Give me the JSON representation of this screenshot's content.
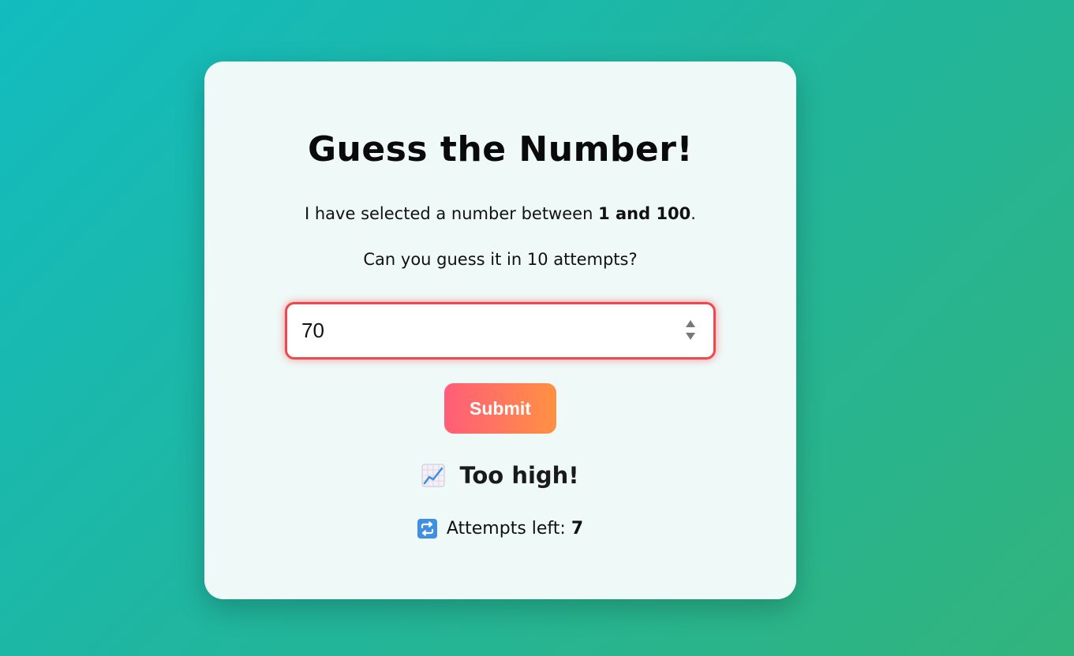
{
  "game": {
    "title": "Guess the Number!",
    "intro_prefix": "I have selected a number between ",
    "intro_range": "1 and 100",
    "intro_suffix": ".",
    "challenge": "Can you guess it in 10 attempts?"
  },
  "guess_input": {
    "value": "70"
  },
  "submit": {
    "label": "Submit"
  },
  "feedback": {
    "icon": "chart-increasing-icon",
    "text": "Too high!"
  },
  "attempts": {
    "icon": "repeat-icon",
    "label": "Attempts left: ",
    "count": "7"
  },
  "colors": {
    "accent_border": "#f0474f",
    "button_gradient_start": "#ff5d78",
    "button_gradient_end": "#ff9142",
    "background_start": "#12bcbf",
    "background_end": "#32b47c",
    "card": "#eff9f7"
  }
}
